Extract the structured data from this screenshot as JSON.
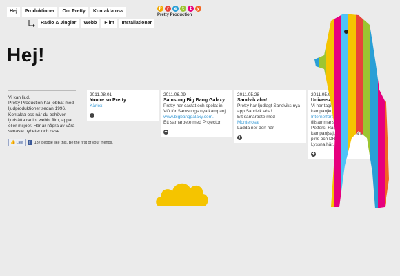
{
  "nav": {
    "items": [
      "Hej",
      "Produktioner",
      "Om Pretty",
      "Kontakta oss"
    ],
    "sub": [
      "Radio & Jinglar",
      "Webb",
      "Film",
      "Installationer"
    ]
  },
  "logo": {
    "letters": [
      "P",
      "r",
      "e",
      "t",
      "t",
      "y"
    ],
    "colors": [
      "#f2a900",
      "#e8433a",
      "#2a9fd6",
      "#9cc531",
      "#e6007e",
      "#f26522"
    ],
    "subtitle": "Pretty Production"
  },
  "page": {
    "title": "Hej!",
    "intro": "Vi kan ljud.\nPretty Production har jobbat med ljudproduktioner sedan 1996. Kontakta oss när du behöver ljudsätta radio, webb, film, appar eller miljöer. Här är några av våra senaste nyheter och case."
  },
  "facebook": {
    "like": "Like",
    "text": "137 people like this. Be the first of your friends."
  },
  "cards": [
    {
      "date": "2011.08.01",
      "title": "You're so Pretty",
      "body": "",
      "link": "Kärlex",
      "after": ""
    },
    {
      "date": "2011.06.09",
      "title": "Samsung Big Bang Galaxy",
      "body": "Pretty har castat och spelat in VO för Samsungs nya kampanj",
      "link": "www.bigbanggalaxy.com.",
      "after": "Ett samarbete med Projector."
    },
    {
      "date": "2011.05.28",
      "title": "Sandvik aha!",
      "body": "Pretty har ljudlagt Sandviks nya app Sandvik aha!\nEtt samarbete med",
      "link": "Monterosa.",
      "after": "Ladda ner den här."
    },
    {
      "date": "2011.05.09",
      "title": "Universal Telecom",
      "body": "Vi har tagit fram kampanjkonceptet",
      "link": "Internetförbättrarna",
      "after": "tillsammans med Secretaire och Petters. Radioreklam, kampanjsajt, banners, annonser, pins och DR.\nLyssna här."
    }
  ],
  "colors": {
    "background": "#ebebeb",
    "link": "#3a9bd6",
    "cloud": "#f5c400"
  },
  "icons": {
    "plus": "plus-circle-icon",
    "subnav": "arrow-elbow-icon"
  }
}
